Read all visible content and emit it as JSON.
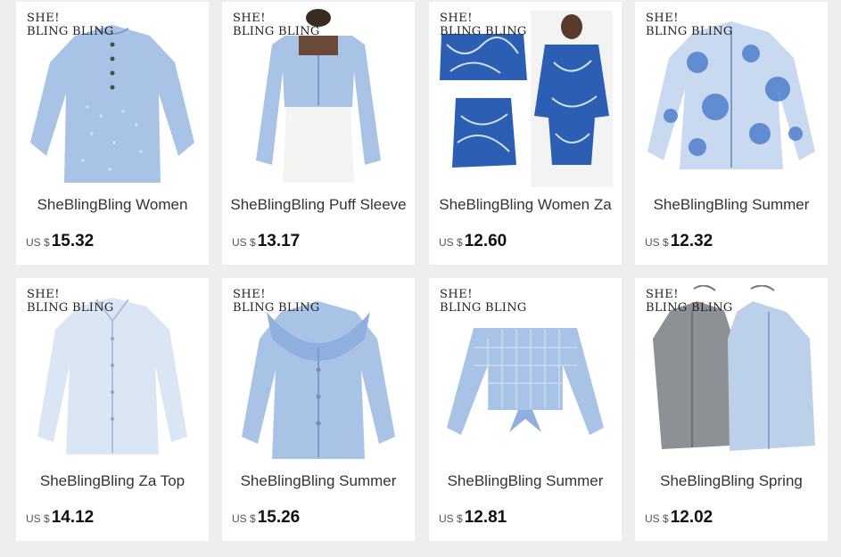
{
  "products": [
    {
      "title": "SheBlingBling Women",
      "currency": "US $",
      "price": "15.32",
      "brand_l1": "SHE!",
      "brand_l2": "BLING BLING"
    },
    {
      "title": "SheBlingBling Puff Sleeve",
      "currency": "US $",
      "price": "13.17",
      "brand_l1": "SHE!",
      "brand_l2": "BLING BLING"
    },
    {
      "title": "SheBlingBling Women Za",
      "currency": "US $",
      "price": "12.60",
      "brand_l1": "SHE!",
      "brand_l2": "BLING BLING"
    },
    {
      "title": "SheBlingBling Summer",
      "currency": "US $",
      "price": "12.32",
      "brand_l1": "SHE!",
      "brand_l2": "BLING BLING"
    },
    {
      "title": "SheBlingBling Za Top",
      "currency": "US $",
      "price": "14.12",
      "brand_l1": "SHE!",
      "brand_l2": "BLING BLING"
    },
    {
      "title": "SheBlingBling Summer",
      "currency": "US $",
      "price": "15.26",
      "brand_l1": "SHE!",
      "brand_l2": "BLING BLING"
    },
    {
      "title": "SheBlingBling Summer",
      "currency": "US $",
      "price": "12.81",
      "brand_l1": "SHE!",
      "brand_l2": "BLING BLING"
    },
    {
      "title": "SheBlingBling Spring",
      "currency": "US $",
      "price": "12.02",
      "brand_l1": "SHE!",
      "brand_l2": "BLING BLING"
    }
  ],
  "colors": {
    "page_bg": "#eeeeee",
    "card_bg": "#ffffff",
    "shirt_light_blue": "#a9c3e6",
    "shirt_pale_blue": "#c9d9ef",
    "print_blue": "#2c5fb3",
    "skirt_white": "#f4f4f2",
    "shirt_gray": "#8d9196"
  }
}
